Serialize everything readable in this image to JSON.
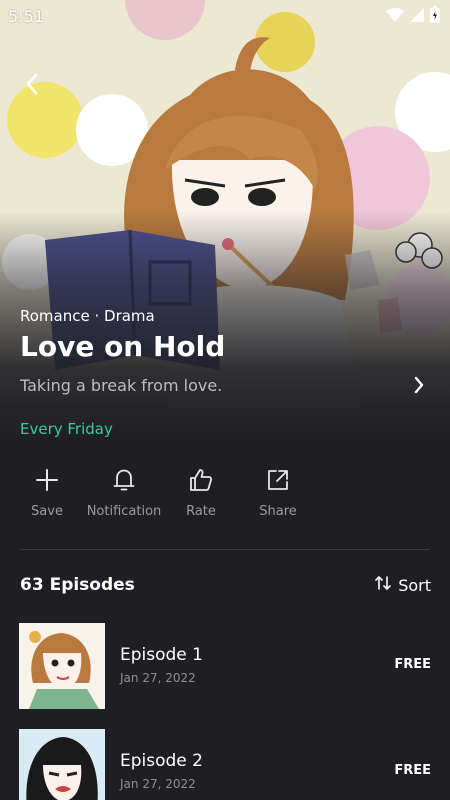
{
  "status_bar": {
    "time": "5:51"
  },
  "series": {
    "genre": "Romance · Drama",
    "title": "Love on Hold",
    "tagline": "Taking a break from love.",
    "schedule": "Every Friday"
  },
  "actions": [
    {
      "label": "Save",
      "icon": "plus-icon"
    },
    {
      "label": "Notification",
      "icon": "bell-icon"
    },
    {
      "label": "Rate",
      "icon": "thumbs-up-icon"
    },
    {
      "label": "Share",
      "icon": "share-icon"
    }
  ],
  "episodes_header": {
    "count_label": "63 Episodes",
    "sort_label": "Sort"
  },
  "episodes": [
    {
      "title": "Episode 1",
      "date": "Jan 27, 2022",
      "price": "FREE"
    },
    {
      "title": "Episode 2",
      "date": "Jan 27, 2022",
      "price": "FREE"
    }
  ],
  "colors": {
    "background": "#1f1f23",
    "accent": "#3ec99a",
    "muted": "#9a9aa0"
  }
}
